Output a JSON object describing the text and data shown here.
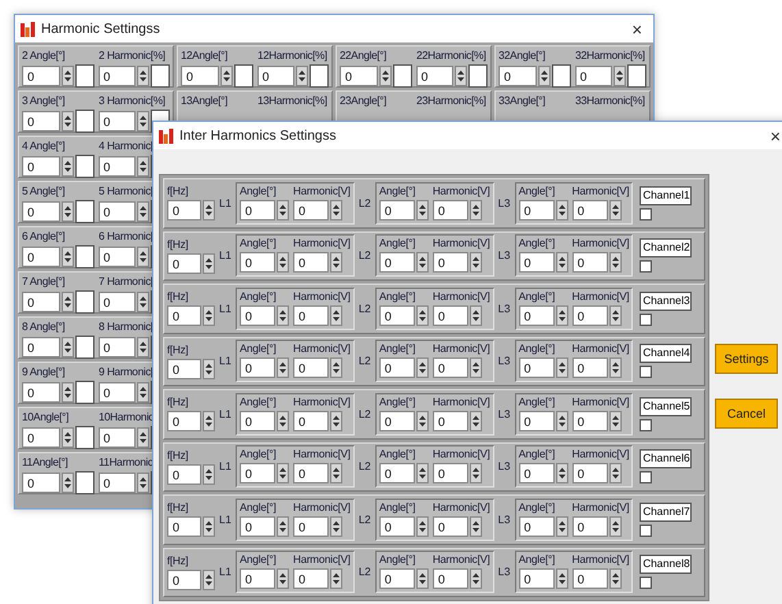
{
  "harmonic_window": {
    "title": "Harmonic Settingss",
    "close": "×",
    "rows": [
      {
        "cells": [
          {
            "angle_label": "2 Angle[°]",
            "angle_value": "0",
            "harmonic_label": "2 Harmonic[%]",
            "harmonic_value": "0"
          },
          {
            "angle_label": "12Angle[°]",
            "angle_value": "0",
            "harmonic_label": "12Harmonic[%]",
            "harmonic_value": "0"
          },
          {
            "angle_label": "22Angle[°]",
            "angle_value": "0",
            "harmonic_label": "22Harmonic[%]",
            "harmonic_value": "0"
          },
          {
            "angle_label": "32Angle[°]",
            "angle_value": "0",
            "harmonic_label": "32Harmonic[%]",
            "harmonic_value": "0"
          }
        ]
      },
      {
        "cells": [
          {
            "angle_label": "3 Angle[°]",
            "angle_value": "0",
            "harmonic_label": "3 Harmonic[%]",
            "harmonic_value": "0"
          },
          {
            "angle_label": "13Angle[°]",
            "harmonic_label": "13Harmonic[%]"
          },
          {
            "angle_label": "23Angle[°]",
            "harmonic_label": "23Harmonic[%]"
          },
          {
            "angle_label": "33Angle[°]",
            "harmonic_label": "33Harmonic[%]"
          }
        ]
      },
      {
        "cells": [
          {
            "angle_label": "4 Angle[°]",
            "angle_value": "0",
            "harmonic_label": "4 Harmonic[",
            "harmonic_value": "0"
          }
        ]
      },
      {
        "cells": [
          {
            "angle_label": "5 Angle[°]",
            "angle_value": "0",
            "harmonic_label": "5 Harmonic[",
            "harmonic_value": "0"
          }
        ]
      },
      {
        "cells": [
          {
            "angle_label": "6 Angle[°]",
            "angle_value": "0",
            "harmonic_label": "6 Harmonic[",
            "harmonic_value": "0"
          }
        ]
      },
      {
        "cells": [
          {
            "angle_label": "7 Angle[°]",
            "angle_value": "0",
            "harmonic_label": "7 Harmonic[",
            "harmonic_value": "0"
          }
        ]
      },
      {
        "cells": [
          {
            "angle_label": "8 Angle[°]",
            "angle_value": "0",
            "harmonic_label": "8 Harmonic[",
            "harmonic_value": "0"
          }
        ]
      },
      {
        "cells": [
          {
            "angle_label": "9 Angle[°]",
            "angle_value": "0",
            "harmonic_label": "9 Harmonic[",
            "harmonic_value": "0"
          }
        ]
      },
      {
        "cells": [
          {
            "angle_label": "10Angle[°]",
            "angle_value": "0",
            "harmonic_label": "10Harmonic",
            "harmonic_value": "0"
          }
        ]
      },
      {
        "cells": [
          {
            "angle_label": "11Angle[°]",
            "angle_value": "0",
            "harmonic_label": "11Harmonic",
            "harmonic_value": "0"
          }
        ]
      }
    ]
  },
  "inter_window": {
    "title": "Inter Harmonics Settingss",
    "close": "×",
    "rows": [
      {
        "freq_label": "f[Hz]",
        "freq_value": "0",
        "phases": [
          {
            "label": "L1",
            "angle_label": "Angle[°]",
            "angle_value": "0",
            "harmonic_label": "Harmonic[V]",
            "harmonic_value": "0"
          },
          {
            "label": "L2",
            "angle_label": "Angle[°]",
            "angle_value": "0",
            "harmonic_label": "Harmonic[V]",
            "harmonic_value": "0"
          },
          {
            "label": "L3",
            "angle_label": "Angle[°]",
            "angle_value": "0",
            "harmonic_label": "Harmonic[V]",
            "harmonic_value": "0"
          }
        ],
        "channel": "Channel1",
        "checked": false
      },
      {
        "freq_label": "f[Hz]",
        "freq_value": "0",
        "phases": [
          {
            "label": "L1",
            "angle_label": "Angle[°]",
            "angle_value": "0",
            "harmonic_label": "Harmonic[V]",
            "harmonic_value": "0"
          },
          {
            "label": "L2",
            "angle_label": "Angle[°]",
            "angle_value": "0",
            "harmonic_label": "Harmonic[V]",
            "harmonic_value": "0"
          },
          {
            "label": "L3",
            "angle_label": "Angle[°]",
            "angle_value": "0",
            "harmonic_label": "Harmonic[V]",
            "harmonic_value": "0"
          }
        ],
        "channel": "Channel2",
        "checked": false
      },
      {
        "freq_label": "f[Hz]",
        "freq_value": "0",
        "phases": [
          {
            "label": "L1",
            "angle_label": "Angle[°]",
            "angle_value": "0",
            "harmonic_label": "Harmonic[V]",
            "harmonic_value": "0"
          },
          {
            "label": "L2",
            "angle_label": "Angle[°]",
            "angle_value": "0",
            "harmonic_label": "Harmonic[V]",
            "harmonic_value": "0"
          },
          {
            "label": "L3",
            "angle_label": "Angle[°]",
            "angle_value": "0",
            "harmonic_label": "Harmonic[V]",
            "harmonic_value": "0"
          }
        ],
        "channel": "Channel3",
        "checked": false
      },
      {
        "freq_label": "f[Hz]",
        "freq_value": "0",
        "phases": [
          {
            "label": "L1",
            "angle_label": "Angle[°]",
            "angle_value": "0",
            "harmonic_label": "Harmonic[V]",
            "harmonic_value": "0"
          },
          {
            "label": "L2",
            "angle_label": "Angle[°]",
            "angle_value": "0",
            "harmonic_label": "Harmonic[V]",
            "harmonic_value": "0"
          },
          {
            "label": "L3",
            "angle_label": "Angle[°]",
            "angle_value": "0",
            "harmonic_label": "Harmonic[V]",
            "harmonic_value": "0"
          }
        ],
        "channel": "Channel4",
        "checked": false
      },
      {
        "freq_label": "f[Hz]",
        "freq_value": "0",
        "phases": [
          {
            "label": "L1",
            "angle_label": "Angle[°]",
            "angle_value": "0",
            "harmonic_label": "Harmonic[V]",
            "harmonic_value": "0"
          },
          {
            "label": "L2",
            "angle_label": "Angle[°]",
            "angle_value": "0",
            "harmonic_label": "Harmonic[V]",
            "harmonic_value": "0"
          },
          {
            "label": "L3",
            "angle_label": "Angle[°]",
            "angle_value": "0",
            "harmonic_label": "Harmonic[V]",
            "harmonic_value": "0"
          }
        ],
        "channel": "Channel5",
        "checked": false
      },
      {
        "freq_label": "f[Hz]",
        "freq_value": "0",
        "phases": [
          {
            "label": "L1",
            "angle_label": "Angle[°]",
            "angle_value": "0",
            "harmonic_label": "Harmonic[V]",
            "harmonic_value": "0"
          },
          {
            "label": "L2",
            "angle_label": "Angle[°]",
            "angle_value": "0",
            "harmonic_label": "Harmonic[V]",
            "harmonic_value": "0"
          },
          {
            "label": "L3",
            "angle_label": "Angle[°]",
            "angle_value": "0",
            "harmonic_label": "Harmonic[V]",
            "harmonic_value": "0"
          }
        ],
        "channel": "Channel6",
        "checked": false
      },
      {
        "freq_label": "f[Hz]",
        "freq_value": "0",
        "phases": [
          {
            "label": "L1",
            "angle_label": "Angle[°]",
            "angle_value": "0",
            "harmonic_label": "Harmonic[V]",
            "harmonic_value": "0"
          },
          {
            "label": "L2",
            "angle_label": "Angle[°]",
            "angle_value": "0",
            "harmonic_label": "Harmonic[V]",
            "harmonic_value": "0"
          },
          {
            "label": "L3",
            "angle_label": "Angle[°]",
            "angle_value": "0",
            "harmonic_label": "Harmonic[V]",
            "harmonic_value": "0"
          }
        ],
        "channel": "Channel7",
        "checked": false
      },
      {
        "freq_label": "f[Hz]",
        "freq_value": "0",
        "phases": [
          {
            "label": "L1",
            "angle_label": "Angle[°]",
            "angle_value": "0",
            "harmonic_label": "Harmonic[V]",
            "harmonic_value": "0"
          },
          {
            "label": "L2",
            "angle_label": "Angle[°]",
            "angle_value": "0",
            "harmonic_label": "Harmonic[V]",
            "harmonic_value": "0"
          },
          {
            "label": "L3",
            "angle_label": "Angle[°]",
            "angle_value": "0",
            "harmonic_label": "Harmonic[V]",
            "harmonic_value": "0"
          }
        ],
        "channel": "Channel8",
        "checked": false
      }
    ],
    "buttons": [
      {
        "label": "Settings"
      },
      {
        "label": "Cancel"
      }
    ]
  }
}
